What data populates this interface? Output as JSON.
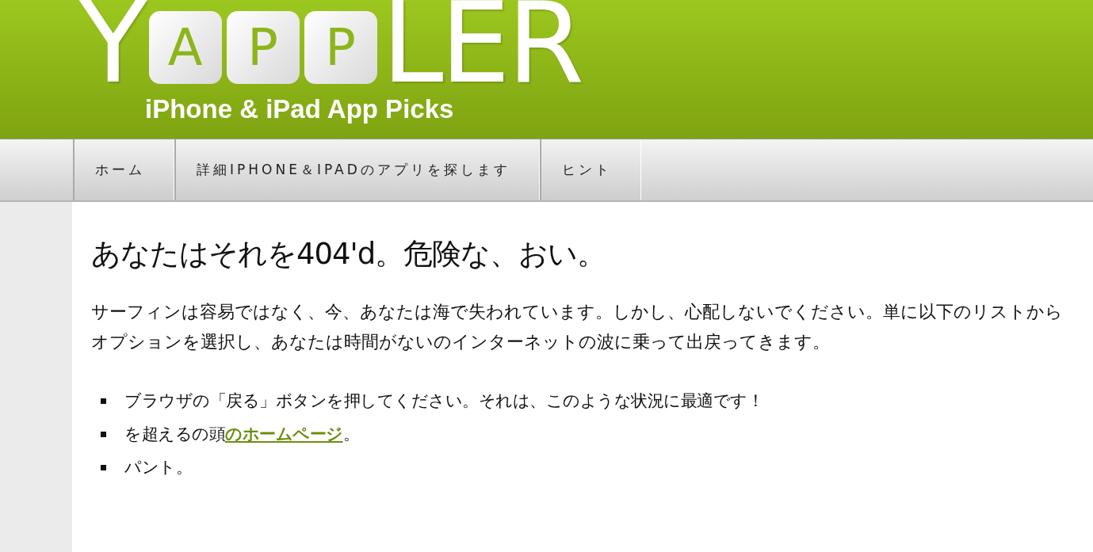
{
  "logo": {
    "letters": [
      {
        "text": "Y",
        "kind": "plain"
      },
      {
        "text": "A",
        "kind": "tile"
      },
      {
        "text": "P",
        "kind": "tile"
      },
      {
        "text": "P",
        "kind": "tile"
      },
      {
        "text": "LER",
        "kind": "plain"
      }
    ],
    "tagline": "iPhone & iPad App Picks"
  },
  "nav": [
    {
      "label": "ホーム"
    },
    {
      "label": "詳細IPHONE＆IPADのアプリを探します"
    },
    {
      "label": "ヒント"
    }
  ],
  "heading": "あなたはそれを404'd。危険な、おい。",
  "paragraph": "サーフィンは容易ではなく、今、あなたは海で失われています。しかし、心配しないでください。単に以下のリストからオプションを選択し、あなたは時間がないのインターネットの波に乗って出戻ってきます。",
  "list": [
    {
      "text": "ブラウザの「戻る」ボタンを押してください。それは、このような状況に最適です！"
    },
    {
      "text": "を超えるの頭",
      "link": "のホームページ",
      "after": "。"
    },
    {
      "text": "パント。"
    }
  ]
}
